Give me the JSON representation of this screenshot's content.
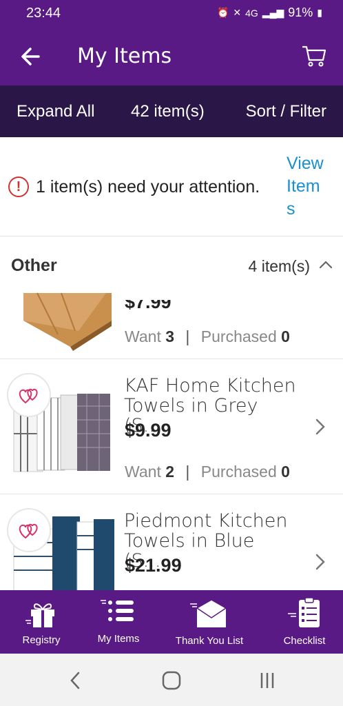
{
  "status": {
    "time": "23:44",
    "network": "4G",
    "battery": "91%"
  },
  "header": {
    "title": "My Items",
    "back_icon": "arrow-left-icon",
    "cart_icon": "cart-icon"
  },
  "actions": {
    "expand_all": "Expand All",
    "item_count": "42 item(s)",
    "sort_filter": "Sort / Filter"
  },
  "alert": {
    "text": "1 item(s) need your attention.",
    "link": "View Items",
    "color": "#d0332f",
    "link_color": "#1a8fd1"
  },
  "section": {
    "title": "Other",
    "count": "4 item(s)"
  },
  "items": [
    {
      "price": "$7.99",
      "want_label": "Want",
      "want": "3",
      "purchased_label": "Purchased",
      "purchased": "0"
    },
    {
      "name": "KAF Home Kitchen Towels in Grey (S...",
      "price": "$9.99",
      "want_label": "Want",
      "want": "2",
      "purchased_label": "Purchased",
      "purchased": "0"
    },
    {
      "name": "Piedmont Kitchen Towels in Blue (S...",
      "price": "$21.99"
    }
  ],
  "nav": [
    {
      "label": "Registry",
      "icon": "gift-icon"
    },
    {
      "label": "My Items",
      "icon": "list-icon"
    },
    {
      "label": "Thank You List",
      "icon": "envelope-icon"
    },
    {
      "label": "Checklist",
      "icon": "clipboard-icon"
    }
  ],
  "colors": {
    "brand": "#5a1a86",
    "action_bar": "#2a1747"
  }
}
